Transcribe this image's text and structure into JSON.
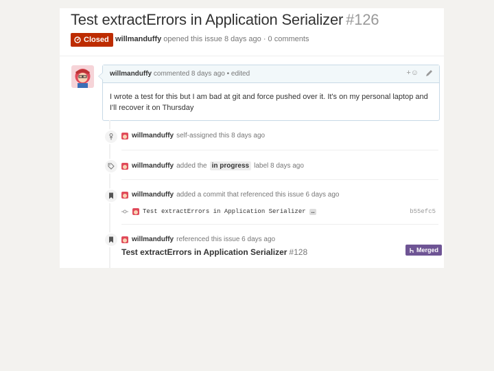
{
  "issue": {
    "title": "Test extractErrors in Application Serializer",
    "number": "#126",
    "state": "Closed",
    "author": "willmanduffy",
    "meta_text": "opened this issue 8 days ago · 0 comments"
  },
  "comment": {
    "author": "willmanduffy",
    "meta": "commented 8 days ago • edited",
    "body": "I wrote a test for this but I am bad at git and force pushed over it. It's on my personal laptop and I'll recover it on Thursday",
    "react_label": "+☺"
  },
  "timeline": [
    {
      "user": "willmanduffy",
      "text": "self-assigned this 8 days ago",
      "icon": "person-icon"
    },
    {
      "user": "willmanduffy",
      "pre": "added the",
      "label": "in progress",
      "post": "label 8 days ago",
      "icon": "tag-icon"
    },
    {
      "user": "willmanduffy",
      "text": "added a commit that referenced this issue 6 days ago",
      "icon": "bookmark-icon"
    },
    {
      "user": "willmanduffy",
      "text": "referenced this issue 6 days ago",
      "icon": "bookmark-icon"
    }
  ],
  "commit": {
    "message": "Test extractErrors in Application Serializer",
    "ellipsis": "…",
    "sha": "b55efc5"
  },
  "reference": {
    "title": "Test extractErrors in Application Serializer",
    "number": "#128",
    "status": "Merged"
  },
  "colors": {
    "closed": "#bd2c00",
    "merged": "#6e5494",
    "comment_border": "#c7d9e6"
  }
}
